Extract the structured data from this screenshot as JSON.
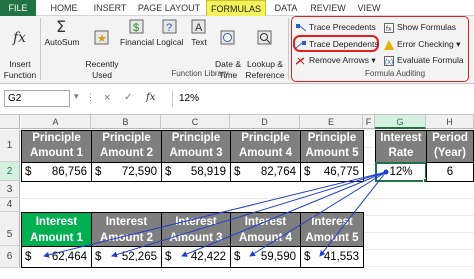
{
  "tabs": [
    "FILE",
    "HOME",
    "INSERT",
    "PAGE LAYOUT",
    "FORMULAS",
    "DATA",
    "REVIEW",
    "VIEW"
  ],
  "ribbon": {
    "insert_function": "Insert\nFunction",
    "autosum": "AutoSum",
    "recently_used": "Recently\nUsed",
    "financial": "Financial",
    "logical": "Logical",
    "text": "Text",
    "date_time": "Date &\nTime",
    "lookup_reference": "Lookup &\nReference",
    "function_library": "Function Library",
    "trace_precedents": "Trace Precedents",
    "trace_dependents": "Trace Dependents",
    "remove_arrows": "Remove Arrows",
    "show_formulas": "Show Formulas",
    "error_checking": "Error Checking",
    "evaluate_formula": "Evaluate Formula",
    "formula_auditing": "Formula Auditing"
  },
  "formula_bar": {
    "name_box": "G2",
    "cancel": "×",
    "enter": "✓",
    "fx": "fx",
    "value": "12%"
  },
  "columns": [
    "A",
    "B",
    "C",
    "D",
    "E",
    "F",
    "G",
    "H"
  ],
  "rows": [
    "1",
    "2",
    "3",
    "4",
    "5",
    "6"
  ],
  "row1_headers": [
    "Principle\nAmount 1",
    "Principle\nAmount 2",
    "Principle\nAmount 3",
    "Principle\nAmount 4",
    "Principle\nAmount 5",
    "Interest\nRate",
    "Period\n(Year)"
  ],
  "row2_values": [
    {
      "cur": "$",
      "num": "86,756"
    },
    {
      "cur": "$",
      "num": "72,590"
    },
    {
      "cur": "$",
      "num": "58,919"
    },
    {
      "cur": "$",
      "num": "82,764"
    },
    {
      "cur": "$",
      "num": "46,775"
    }
  ],
  "interest_rate": "12%",
  "period": "6",
  "row5_headers": [
    "Interest\nAmount 1",
    "Interest\nAmount 2",
    "Interest\nAmount 3",
    "Interest\nAmount 4",
    "Interest\nAmount 5"
  ],
  "row6_values": [
    {
      "cur": "$",
      "num": "62,464"
    },
    {
      "cur": "$",
      "num": "52,265"
    },
    {
      "cur": "$",
      "num": "42,422"
    },
    {
      "cur": "$",
      "num": "59,590"
    },
    {
      "cur": "$",
      "num": "41,553"
    }
  ],
  "colors": {
    "excel_green": "#217346",
    "header_gray": "#7f7f7f",
    "header_green": "#00b050",
    "arrow_blue": "#1f3fd0",
    "highlight_red": "#e02020"
  }
}
